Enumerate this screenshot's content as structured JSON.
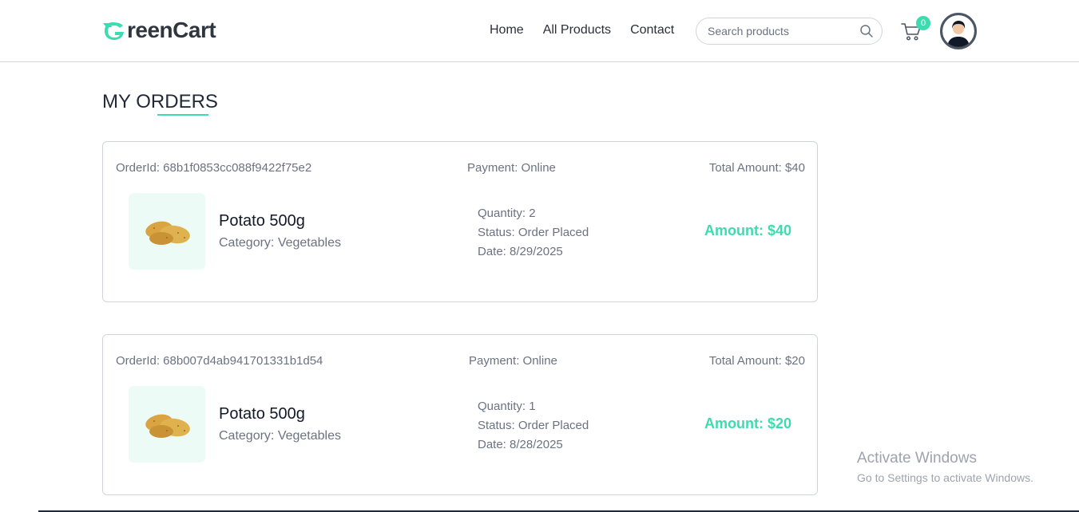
{
  "brand": {
    "name": "reenCart",
    "accent": "#3ddbb0"
  },
  "nav": {
    "links": [
      "Home",
      "All Products",
      "Contact"
    ],
    "search_placeholder": "Search products",
    "cart_count": "0"
  },
  "page": {
    "title": "MY ORDERS"
  },
  "orders": [
    {
      "order_id": "OrderId: 68b1f0853cc088f9422f75e2",
      "payment": "Payment: Online",
      "total": "Total Amount: $40",
      "product_name": "Potato 500g",
      "category": "Category: Vegetables",
      "quantity": "Quantity: 2",
      "status": "Status: Order Placed",
      "date": "Date: 8/29/2025",
      "amount": "Amount: $40"
    },
    {
      "order_id": "OrderId: 68b007d4ab941701331b1d54",
      "payment": "Payment: Online",
      "total": "Total Amount: $20",
      "product_name": "Potato 500g",
      "category": "Category: Vegetables",
      "quantity": "Quantity: 1",
      "status": "Status: Order Placed",
      "date": "Date: 8/28/2025",
      "amount": "Amount: $20"
    }
  ],
  "watermark": {
    "title": "Activate Windows",
    "subtitle": "Go to Settings to activate Windows."
  }
}
